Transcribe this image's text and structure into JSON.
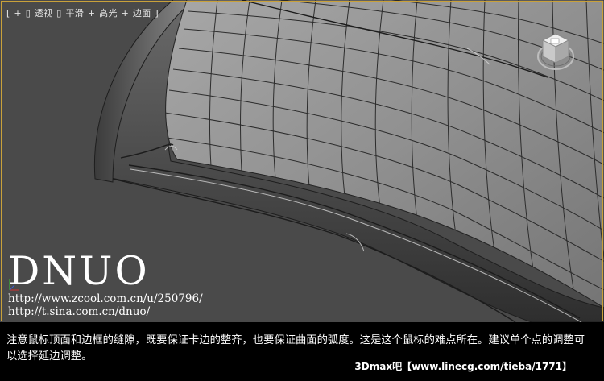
{
  "viewport": {
    "label_parts": [
      "[",
      "+",
      "▯",
      "透视",
      "▯",
      "平滑",
      "+",
      "高光",
      "+",
      "边面",
      "]"
    ],
    "accent_border": "#c9a13a",
    "background": "#4a4a4a"
  },
  "watermark": {
    "brand": "DNUO",
    "link_1": "http://www.zcool.com.cn/u/250796/",
    "link_2": "http://t.sina.com.cn/dnuo/"
  },
  "caption": {
    "text": "注意鼠标顶面和边框的缝隙，既要保证卡边的整齐，也要保证曲面的弧度。这是这个鼠标的难点所在。建议单个点的调整可以选择延边调整。",
    "source": "3Dmax吧【www.linecg.com/tieba/1771】"
  },
  "icons": {
    "viewcube": "viewcube-icon",
    "axis": "axis-tripod-icon"
  }
}
